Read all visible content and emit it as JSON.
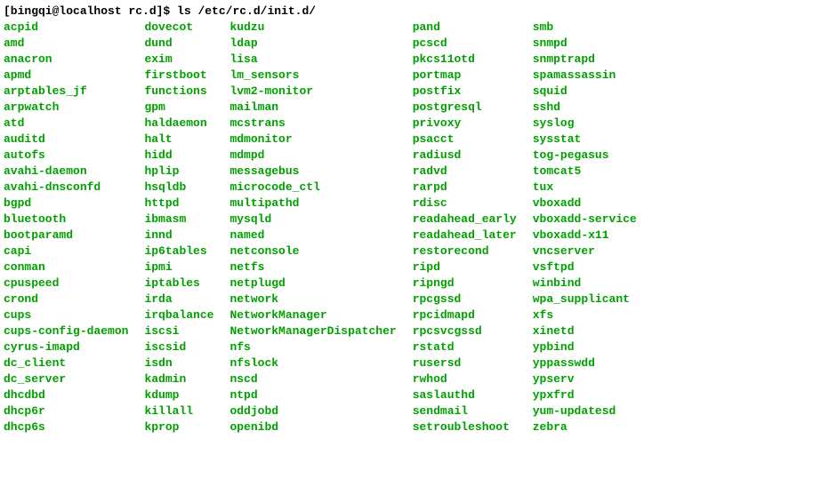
{
  "prompt": {
    "userhost": "[bingqi@localhost rc.d]$",
    "command": "ls /etc/rc.d/init.d/"
  },
  "files": {
    "col1": [
      "acpid",
      "amd",
      "anacron",
      "apmd",
      "arptables_jf",
      "arpwatch",
      "atd",
      "auditd",
      "autofs",
      "avahi-daemon",
      "avahi-dnsconfd",
      "bgpd",
      "bluetooth",
      "bootparamd",
      "capi",
      "conman",
      "cpuspeed",
      "crond",
      "cups",
      "cups-config-daemon",
      "cyrus-imapd",
      "dc_client",
      "dc_server",
      "dhcdbd",
      "dhcp6r",
      "dhcp6s"
    ],
    "col2": [
      "dovecot",
      "dund",
      "exim",
      "firstboot",
      "functions",
      "gpm",
      "haldaemon",
      "halt",
      "hidd",
      "hplip",
      "hsqldb",
      "httpd",
      "ibmasm",
      "innd",
      "ip6tables",
      "ipmi",
      "iptables",
      "irda",
      "irqbalance",
      "iscsi",
      "iscsid",
      "isdn",
      "kadmin",
      "kdump",
      "killall",
      "kprop"
    ],
    "col3": [
      "kudzu",
      "ldap",
      "lisa",
      "lm_sensors",
      "lvm2-monitor",
      "mailman",
      "mcstrans",
      "mdmonitor",
      "mdmpd",
      "messagebus",
      "microcode_ctl",
      "multipathd",
      "mysqld",
      "named",
      "netconsole",
      "netfs",
      "netplugd",
      "network",
      "NetworkManager",
      "NetworkManagerDispatcher",
      "nfs",
      "nfslock",
      "nscd",
      "ntpd",
      "oddjobd",
      "openibd"
    ],
    "col4": [
      "pand",
      "pcscd",
      "pkcs11otd",
      "portmap",
      "postfix",
      "postgresql",
      "privoxy",
      "psacct",
      "radiusd",
      "radvd",
      "rarpd",
      "rdisc",
      "readahead_early",
      "readahead_later",
      "restorecond",
      "ripd",
      "ripngd",
      "rpcgssd",
      "rpcidmapd",
      "rpcsvcgssd",
      "rstatd",
      "rusersd",
      "rwhod",
      "saslauthd",
      "sendmail",
      "setroubleshoot"
    ],
    "col5": [
      "smb",
      "snmpd",
      "snmptrapd",
      "spamassassin",
      "squid",
      "sshd",
      "syslog",
      "sysstat",
      "tog-pegasus",
      "tomcat5",
      "tux",
      "vboxadd",
      "vboxadd-service",
      "vboxadd-x11",
      "vncserver",
      "vsftpd",
      "winbind",
      "wpa_supplicant",
      "xfs",
      "xinetd",
      "ypbind",
      "yppasswdd",
      "ypserv",
      "ypxfrd",
      "yum-updatesd",
      "zebra"
    ]
  }
}
